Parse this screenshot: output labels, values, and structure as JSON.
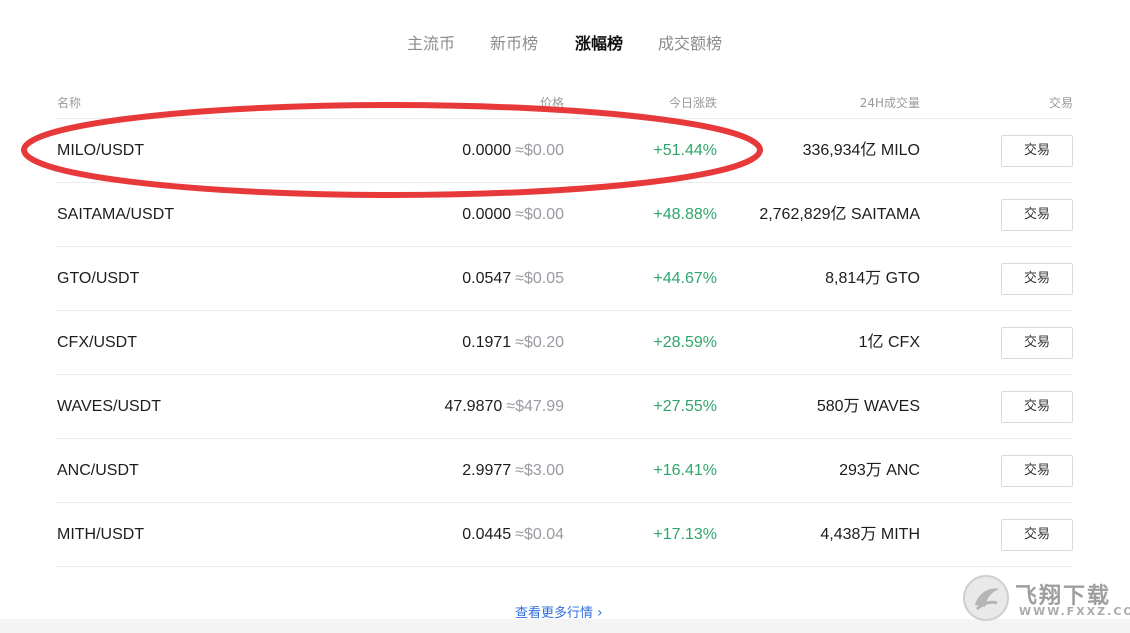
{
  "tabs": [
    {
      "label": "主流币",
      "active": false
    },
    {
      "label": "新币榜",
      "active": false
    },
    {
      "label": "涨幅榜",
      "active": true
    },
    {
      "label": "成交额榜",
      "active": false
    }
  ],
  "table": {
    "headers": {
      "name": "名称",
      "price": "价格",
      "change": "今日涨跌",
      "volume": "24H成交量",
      "trade": "交易"
    },
    "rows": [
      {
        "pair": "MILO/USDT",
        "price": "0.0000",
        "usd": "≈$0.00",
        "change": "+51.44%",
        "volume": "336,934亿 MILO",
        "action": "交易"
      },
      {
        "pair": "SAITAMA/USDT",
        "price": "0.0000",
        "usd": "≈$0.00",
        "change": "+48.88%",
        "volume": "2,762,829亿 SAITAMA",
        "action": "交易"
      },
      {
        "pair": "GTO/USDT",
        "price": "0.0547",
        "usd": "≈$0.05",
        "change": "+44.67%",
        "volume": "8,814万 GTO",
        "action": "交易"
      },
      {
        "pair": "CFX/USDT",
        "price": "0.1971",
        "usd": "≈$0.20",
        "change": "+28.59%",
        "volume": "1亿 CFX",
        "action": "交易"
      },
      {
        "pair": "WAVES/USDT",
        "price": "47.9870",
        "usd": "≈$47.99",
        "change": "+27.55%",
        "volume": "580万 WAVES",
        "action": "交易"
      },
      {
        "pair": "ANC/USDT",
        "price": "2.9977",
        "usd": "≈$3.00",
        "change": "+16.41%",
        "volume": "293万 ANC",
        "action": "交易"
      },
      {
        "pair": "MITH/USDT",
        "price": "0.0445",
        "usd": "≈$0.04",
        "change": "+17.13%",
        "volume": "4,438万 MITH",
        "action": "交易"
      }
    ]
  },
  "more_link": {
    "label": "查看更多行情",
    "icon": "chevron-right-icon"
  },
  "annotation": {
    "shape": "red-ellipse",
    "color": "#e8393a",
    "target": "MILO/USDT row"
  },
  "watermark": {
    "title": "飞翔下载",
    "subtitle": "WWW.FXXZ.COM"
  },
  "colors": {
    "positive": "#2ea66b",
    "muted": "#9a9ba3",
    "link": "#2f6fde",
    "annotation": "#e8393a"
  }
}
